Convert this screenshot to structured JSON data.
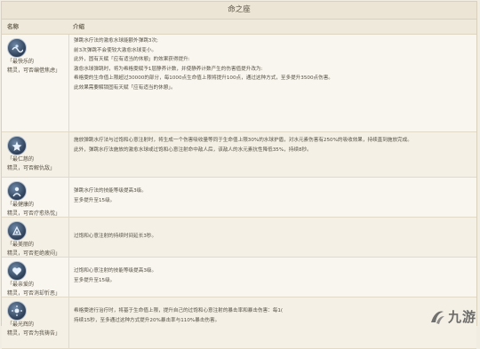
{
  "panel": {
    "title": "命之座",
    "col_name": "名称",
    "col_desc": "介绍"
  },
  "rows": [
    {
      "name_head": "「最快乐的",
      "name_tail": "精灵，可否编借焦虑」",
      "icon": "spirit-wave-icon",
      "lines": [
        "弹跳水疗法的激愈水球能额外弹跳3次;",
        "前3次弹跳不会使较大激愈水球变小。",
        "此外，固有天赋「应有适当的休憩」的效果获得提升:",
        "激愈水球弹跳时，将为希格雯赋予1层静养计数，并使静养计数产生的伤害值提升改为:",
        "希格雯的生命值上限超过30000的部分，每1000点生命值上限将提升100点，通过这种方式，至多提升3500点伤害。",
        "此效果需要解锁固有天赋「应有适当的休憩」。"
      ]
    },
    {
      "name_head": "「最仁慈的",
      "name_tail": "精灵，可否解仇敌」",
      "icon": "spirit-heal-icon",
      "lines": [
        "施放弹跳水疗法与过饱和心意注射时，将生成一个伤害吸收量等同于生命值上限30%的水球护盾，对水元素伤害有250%的吸收效果，持续直到施放完成。",
        "此外，弹跳水疗法施放的激愈水球或过饱和心意注射命中敌人后，该敌人的水元素抗性降低35%，持续8秒。"
      ]
    },
    {
      "name_head": "「最健康的",
      "name_tail": "精灵，可否疗愈热忱」",
      "icon": "spirit-health-icon",
      "lines": [
        "弹跳水疗法的技能等级提高3级。",
        "至多提升至15级。"
      ]
    },
    {
      "name_head": "「最美丽的",
      "name_tail": "精灵，可否拒绝疲闷」",
      "icon": "spirit-beauty-icon",
      "lines": [
        "过饱和心意注射的持续时间延长3秒。"
      ]
    },
    {
      "name_head": "「最亲爱的",
      "name_tail": "精灵，可否消却忻恶」",
      "icon": "spirit-dear-icon",
      "lines": [
        "过饱和心意注射的技能等级提高3级。",
        "至多提升至15级。"
      ]
    },
    {
      "name_head": "「最光辉的",
      "name_tail": "精灵，可否为我祷告」",
      "icon": "spirit-radiant-icon",
      "lines": [
        "希格雯进行治疗时，将基于生命值上限，提升自己的过饱和心意注射的暴击率和暴击伤害：每1(",
        "持续15秒，至多通过这种方式提升20%暴击率与110%暴击伤害。"
      ]
    }
  ],
  "watermark": {
    "text": "九游",
    "icon": "jiuyou-logo-icon"
  }
}
